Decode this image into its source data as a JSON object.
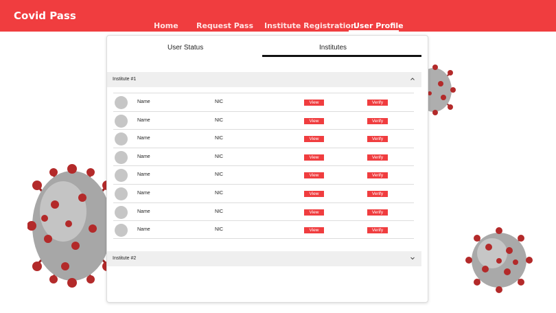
{
  "app": {
    "title": "Covid Pass"
  },
  "nav": {
    "items": [
      {
        "label": "Home"
      },
      {
        "label": "Request Pass"
      },
      {
        "label": "Institute Registration"
      },
      {
        "label": "User Profile"
      }
    ],
    "active": "User Profile"
  },
  "tabs": [
    {
      "label": "User Status"
    },
    {
      "label": "Institutes"
    }
  ],
  "active_tab": "Institutes",
  "accordions": [
    {
      "title": "Institute #1",
      "expanded": true,
      "chevron": "chevron-up-icon"
    },
    {
      "title": "Institute #2",
      "expanded": false,
      "chevron": "chevron-down-icon"
    }
  ],
  "members": [
    {
      "name": "Name",
      "nic": "NIC",
      "view_label": "View",
      "verify_label": "Verify"
    },
    {
      "name": "Name",
      "nic": "NIC",
      "view_label": "View",
      "verify_label": "Verify"
    },
    {
      "name": "Name",
      "nic": "NIC",
      "view_label": "View",
      "verify_label": "Verify"
    },
    {
      "name": "Name",
      "nic": "NIC",
      "view_label": "View",
      "verify_label": "Verify"
    },
    {
      "name": "Name",
      "nic": "NIC",
      "view_label": "View",
      "verify_label": "Verify"
    },
    {
      "name": "Name",
      "nic": "NIC",
      "view_label": "View",
      "verify_label": "Verify"
    },
    {
      "name": "Name",
      "nic": "NIC",
      "view_label": "View",
      "verify_label": "Verify"
    },
    {
      "name": "Name",
      "nic": "NIC",
      "view_label": "View",
      "verify_label": "Verify"
    }
  ],
  "colors": {
    "brand": "#f03d3f",
    "tab_active": "#111111",
    "accordion_bg": "#efefef",
    "avatar": "#c6c6c6"
  }
}
